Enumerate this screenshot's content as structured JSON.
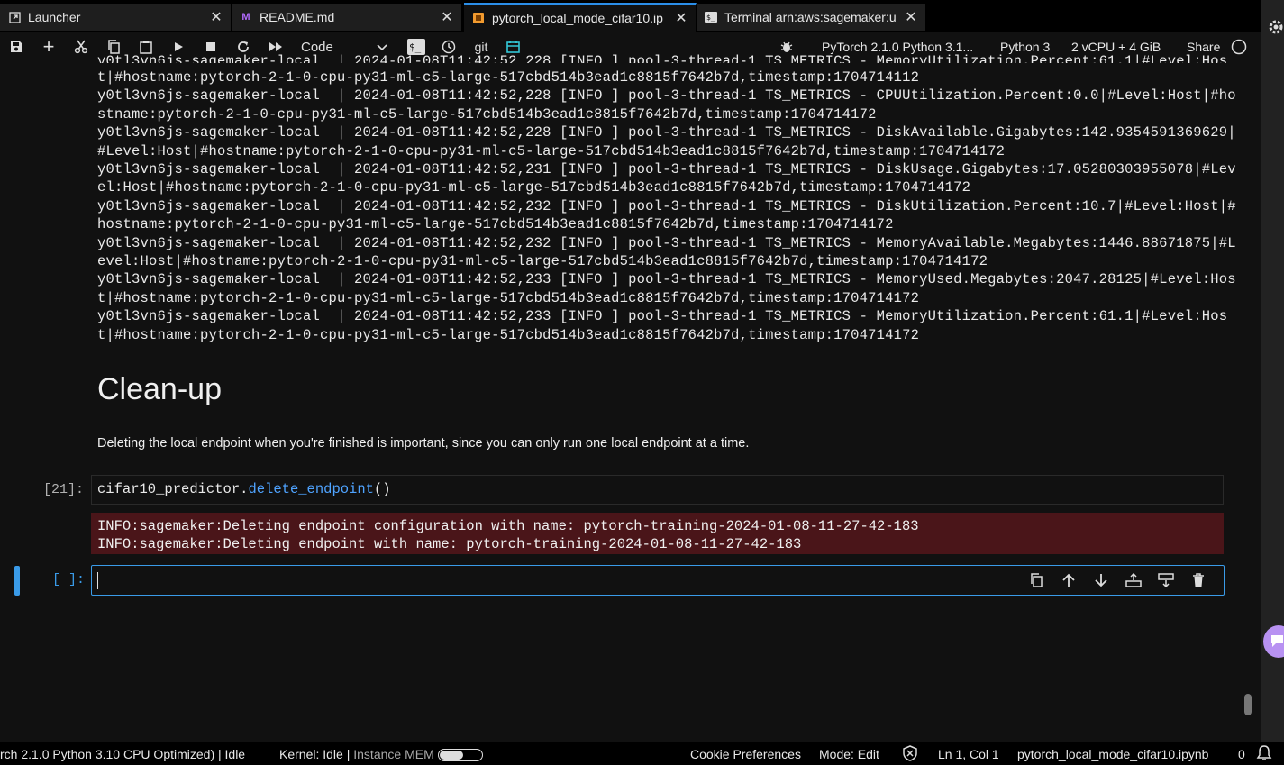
{
  "tabs": [
    {
      "label": "Launcher",
      "icon": "launcher-icon",
      "active": false
    },
    {
      "label": "README.md",
      "icon": "markdown-icon",
      "active": false
    },
    {
      "label": "pytorch_local_mode_cifar10.ip",
      "icon": "notebook-icon",
      "active": true
    },
    {
      "label": "Terminal arn:aws:sagemaker:u",
      "icon": "terminal-icon",
      "active": false
    }
  ],
  "toolbar": {
    "cell_type": "Code",
    "git_label": "git",
    "kernel_name": "PyTorch 2.1.0 Python 3.1...",
    "kernel_lang": "Python 3",
    "instance": "2 vCPU + 4 GiB",
    "share_label": "Share"
  },
  "output_lines": [
    "t|#hostname:pytorch-2-1-0-cpu-py31-ml-c5-large-517cbd514b3ead1c8815f7642b7d,timestamp:1704714112",
    "y0tl3vn6js-sagemaker-local  | 2024-01-08T11:42:52,228 [INFO ] pool-3-thread-1 TS_METRICS - CPUUtilization.Percent:0.0|#Level:Host|#ho",
    "stname:pytorch-2-1-0-cpu-py31-ml-c5-large-517cbd514b3ead1c8815f7642b7d,timestamp:1704714172",
    "y0tl3vn6js-sagemaker-local  | 2024-01-08T11:42:52,228 [INFO ] pool-3-thread-1 TS_METRICS - DiskAvailable.Gigabytes:142.9354591369629|",
    "#Level:Host|#hostname:pytorch-2-1-0-cpu-py31-ml-c5-large-517cbd514b3ead1c8815f7642b7d,timestamp:1704714172",
    "y0tl3vn6js-sagemaker-local  | 2024-01-08T11:42:52,231 [INFO ] pool-3-thread-1 TS_METRICS - DiskUsage.Gigabytes:17.05280303955078|#Lev",
    "el:Host|#hostname:pytorch-2-1-0-cpu-py31-ml-c5-large-517cbd514b3ead1c8815f7642b7d,timestamp:1704714172",
    "y0tl3vn6js-sagemaker-local  | 2024-01-08T11:42:52,232 [INFO ] pool-3-thread-1 TS_METRICS - DiskUtilization.Percent:10.7|#Level:Host|#",
    "hostname:pytorch-2-1-0-cpu-py31-ml-c5-large-517cbd514b3ead1c8815f7642b7d,timestamp:1704714172",
    "y0tl3vn6js-sagemaker-local  | 2024-01-08T11:42:52,232 [INFO ] pool-3-thread-1 TS_METRICS - MemoryAvailable.Megabytes:1446.88671875|#L",
    "evel:Host|#hostname:pytorch-2-1-0-cpu-py31-ml-c5-large-517cbd514b3ead1c8815f7642b7d,timestamp:1704714172",
    "y0tl3vn6js-sagemaker-local  | 2024-01-08T11:42:52,233 [INFO ] pool-3-thread-1 TS_METRICS - MemoryUsed.Megabytes:2047.28125|#Level:Hos",
    "t|#hostname:pytorch-2-1-0-cpu-py31-ml-c5-large-517cbd514b3ead1c8815f7642b7d,timestamp:1704714172",
    "y0tl3vn6js-sagemaker-local  | 2024-01-08T11:42:52,233 [INFO ] pool-3-thread-1 TS_METRICS - MemoryUtilization.Percent:61.1|#Level:Hos",
    "t|#hostname:pytorch-2-1-0-cpu-py31-ml-c5-large-517cbd514b3ead1c8815f7642b7d,timestamp:1704714172"
  ],
  "markdown": {
    "heading": "Clean-up",
    "paragraph": "Deleting the local endpoint when you're finished is important, since you can only run one local endpoint at a time."
  },
  "cell21": {
    "prompt": "[21]:",
    "code_obj": "cifar10_predictor.",
    "code_fn": "delete_endpoint",
    "code_tail": "()",
    "stderr_lines": [
      "INFO:sagemaker:Deleting endpoint configuration with name: pytorch-training-2024-01-08-11-27-42-183",
      "INFO:sagemaker:Deleting endpoint with name: pytorch-training-2024-01-08-11-27-42-183"
    ]
  },
  "empty_cell": {
    "prompt": "[ ]:"
  },
  "statusbar": {
    "kernel_info": "rch 2.1.0 Python 3.10 CPU Optimized) | Idle",
    "kernel_state": "Kernel: Idle |",
    "instance_mem": "Instance MEM",
    "cookie": "Cookie Preferences",
    "mode": "Mode: Edit",
    "position": "Ln 1, Col 1",
    "filename": "pytorch_local_mode_cifar10.ipynb",
    "notifications": "0"
  },
  "colors": {
    "accent": "#3a9be8",
    "stderr_bg": "#4a1519",
    "function": "#4fa3ff"
  }
}
